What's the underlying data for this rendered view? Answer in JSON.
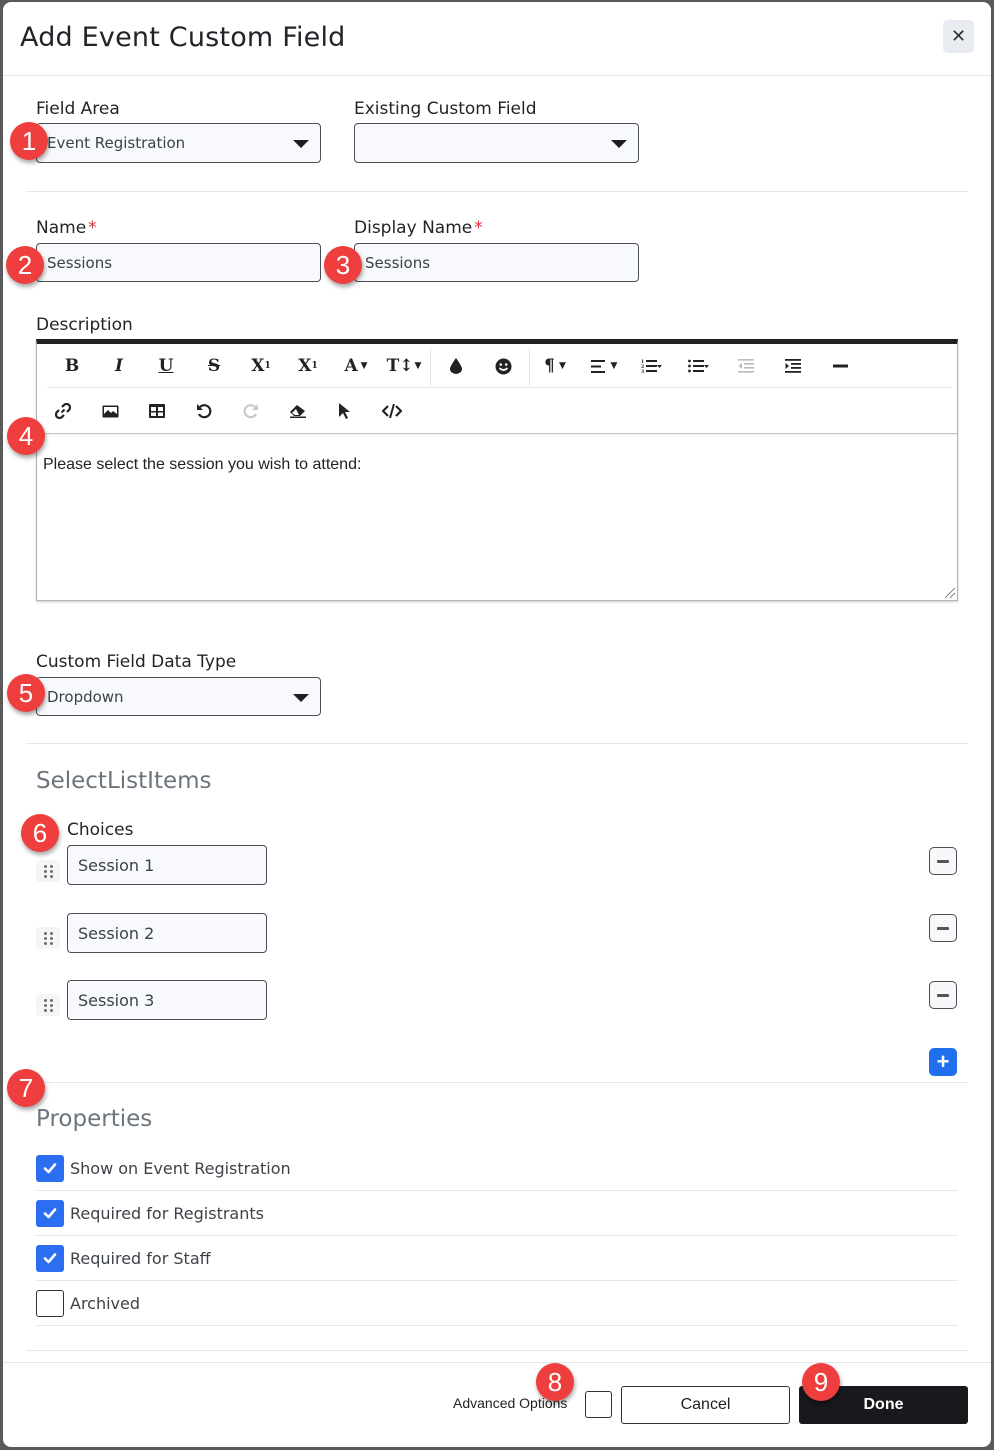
{
  "dialog": {
    "title": "Add Event Custom Field",
    "close_icon": "close-icon"
  },
  "field_area": {
    "label": "Field Area",
    "value": "Event Registration"
  },
  "existing_custom_field": {
    "label": "Existing Custom Field",
    "value": ""
  },
  "name": {
    "label": "Name",
    "required_mark": "*",
    "value": "Sessions"
  },
  "display_name": {
    "label": "Display Name",
    "required_mark": "*",
    "value": "Sessions"
  },
  "description": {
    "label": "Description",
    "content": "Please select the session you wish to attend:",
    "toolbar_row1": [
      "bold-icon",
      "italic-icon",
      "underline-icon",
      "strikethrough-icon",
      "subscript-icon",
      "superscript-icon",
      "font-color-dropdown",
      "font-size-dropdown",
      "color-drop-icon",
      "emoji-icon",
      "paragraph-dropdown",
      "align-dropdown",
      "ordered-list-icon",
      "unordered-list-icon",
      "outdent-icon",
      "indent-icon",
      "horizontal-rule-icon"
    ],
    "toolbar_row2": [
      "link-icon",
      "image-icon",
      "table-icon",
      "undo-icon",
      "redo-icon",
      "eraser-icon",
      "select-icon",
      "code-view-icon"
    ]
  },
  "data_type": {
    "label": "Custom Field Data Type",
    "value": "Dropdown"
  },
  "select_list_items": {
    "title": "SelectListItems",
    "choices_label": "Choices",
    "choices": [
      "Session 1",
      "Session 2",
      "Session 3"
    ]
  },
  "properties": {
    "title": "Properties",
    "items": [
      {
        "label": "Show on Event Registration",
        "checked": true
      },
      {
        "label": "Required for Registrants",
        "checked": true
      },
      {
        "label": "Required for Staff",
        "checked": true
      },
      {
        "label": "Archived",
        "checked": false
      }
    ]
  },
  "footer": {
    "advanced_options_label": "Advanced Options",
    "advanced_options_checked": false,
    "cancel_label": "Cancel",
    "done_label": "Done"
  },
  "markers": [
    "1",
    "2",
    "3",
    "4",
    "5",
    "6",
    "7",
    "8",
    "9"
  ],
  "colors": {
    "primary": "#2b6ef2",
    "required": "#d92a3a",
    "marker": "#ee3e3e",
    "done_button": "#18191c"
  }
}
